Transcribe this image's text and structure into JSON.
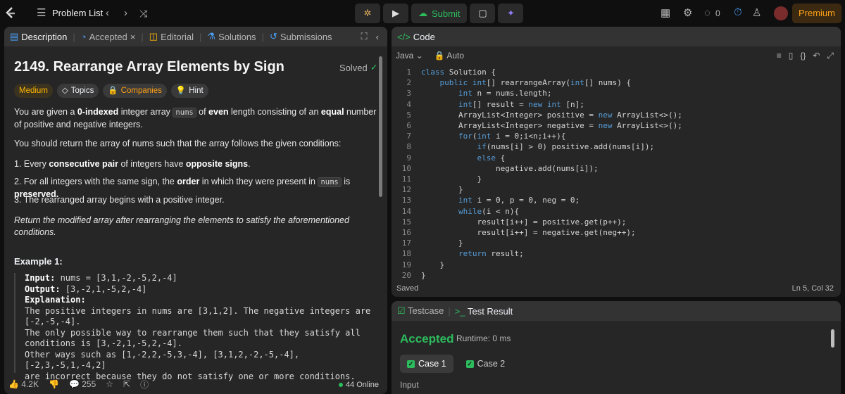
{
  "topbar": {
    "problem_list_label": "Problem List",
    "submit_label": "Submit",
    "timer_value": "0",
    "premium_label": "Premium"
  },
  "left_tabs": [
    {
      "label": "Description",
      "active": true
    },
    {
      "label": "Accepted",
      "active": false
    },
    {
      "label": "Editorial",
      "active": false
    },
    {
      "label": "Solutions",
      "active": false
    },
    {
      "label": "Submissions",
      "active": false
    }
  ],
  "problem": {
    "title": "2149. Rearrange Array Elements by Sign",
    "status": "Solved",
    "tags": {
      "difficulty": "Medium",
      "topics": "Topics",
      "companies": "Companies",
      "hint": "Hint"
    },
    "desc_p1_a": "You are given a ",
    "desc_p1_b": "0-indexed",
    "desc_p1_c": " integer array ",
    "desc_p1_code": "nums",
    "desc_p1_d": " of ",
    "desc_p1_e": "even",
    "desc_p1_f": " length consisting of an ",
    "desc_p1_g": "equal",
    "desc_p1_h": " number of positive and negative integers.",
    "desc_p2": "You should return the array of nums such that the array follows the given conditions:",
    "cond1_a": "1. Every ",
    "cond1_b": "consecutive pair",
    "cond1_c": " of integers have ",
    "cond1_d": "opposite signs",
    "cond1_e": ".",
    "cond2_a": "2. For all integers with the same sign, the ",
    "cond2_b": "order",
    "cond2_c": " in which they were present in ",
    "cond2_code": "nums",
    "cond2_d": " is ",
    "cond2_e": "preserved.",
    "cond3": "3. The rearranged array begins with a positive integer.",
    "return_text": "Return the modified array after rearranging the elements to satisfy the aforementioned conditions.",
    "example_title": "Example 1:",
    "ex_input_label": "Input:",
    "ex_input_value": " nums = [3,1,-2,-5,2,-4]",
    "ex_output_label": "Output:",
    "ex_output_value": " [3,-2,1,-5,2,-4]",
    "ex_expl_label": "Explanation:",
    "ex_expl_lines": [
      "The positive integers in nums are [3,1,2]. The negative integers are",
      "[-2,-5,-4].",
      "The only possible way to rearrange them such that they satisfy all",
      "conditions is [3,-2,1,-5,2,-4].",
      "Other ways such as [1,-2,2,-5,3,-4], [3,1,2,-2,-5,-4], [-2,3,-5,1,-4,2]",
      "are incorrect because they do not satisfy one or more conditions."
    ]
  },
  "left_footer": {
    "likes": "4.2K",
    "comments": "255",
    "online": "44 Online"
  },
  "code_panel": {
    "header": "Code",
    "language": "Java",
    "mode": "Auto",
    "lines": [
      "class Solution {",
      "    public int[] rearrangeArray(int[] nums) {",
      "        int n = nums.length;",
      "        int[] result = new int [n];",
      "        ArrayList<Integer> positive = new ArrayList<>();",
      "        ArrayList<Integer> negative = new ArrayList<>();",
      "        for(int i = 0;i<n;i++){",
      "            if(nums[i] > 0) positive.add(nums[i]);",
      "            else {",
      "                negative.add(nums[i]);",
      "            }",
      "        }",
      "        int i = 0, p = 0, neg = 0;",
      "        while(i < n){",
      "            result[i++] = positive.get(p++);",
      "            result[i++] = negative.get(neg++);",
      "        }",
      "        return result;",
      "    }",
      "}"
    ],
    "saved": "Saved",
    "cursor": "Ln 5, Col 32"
  },
  "result_panel": {
    "tab_testcase": "Testcase",
    "tab_result": "Test Result",
    "status": "Accepted",
    "runtime": "Runtime: 0 ms",
    "cases": [
      "Case 1",
      "Case 2"
    ],
    "input_label": "Input"
  }
}
